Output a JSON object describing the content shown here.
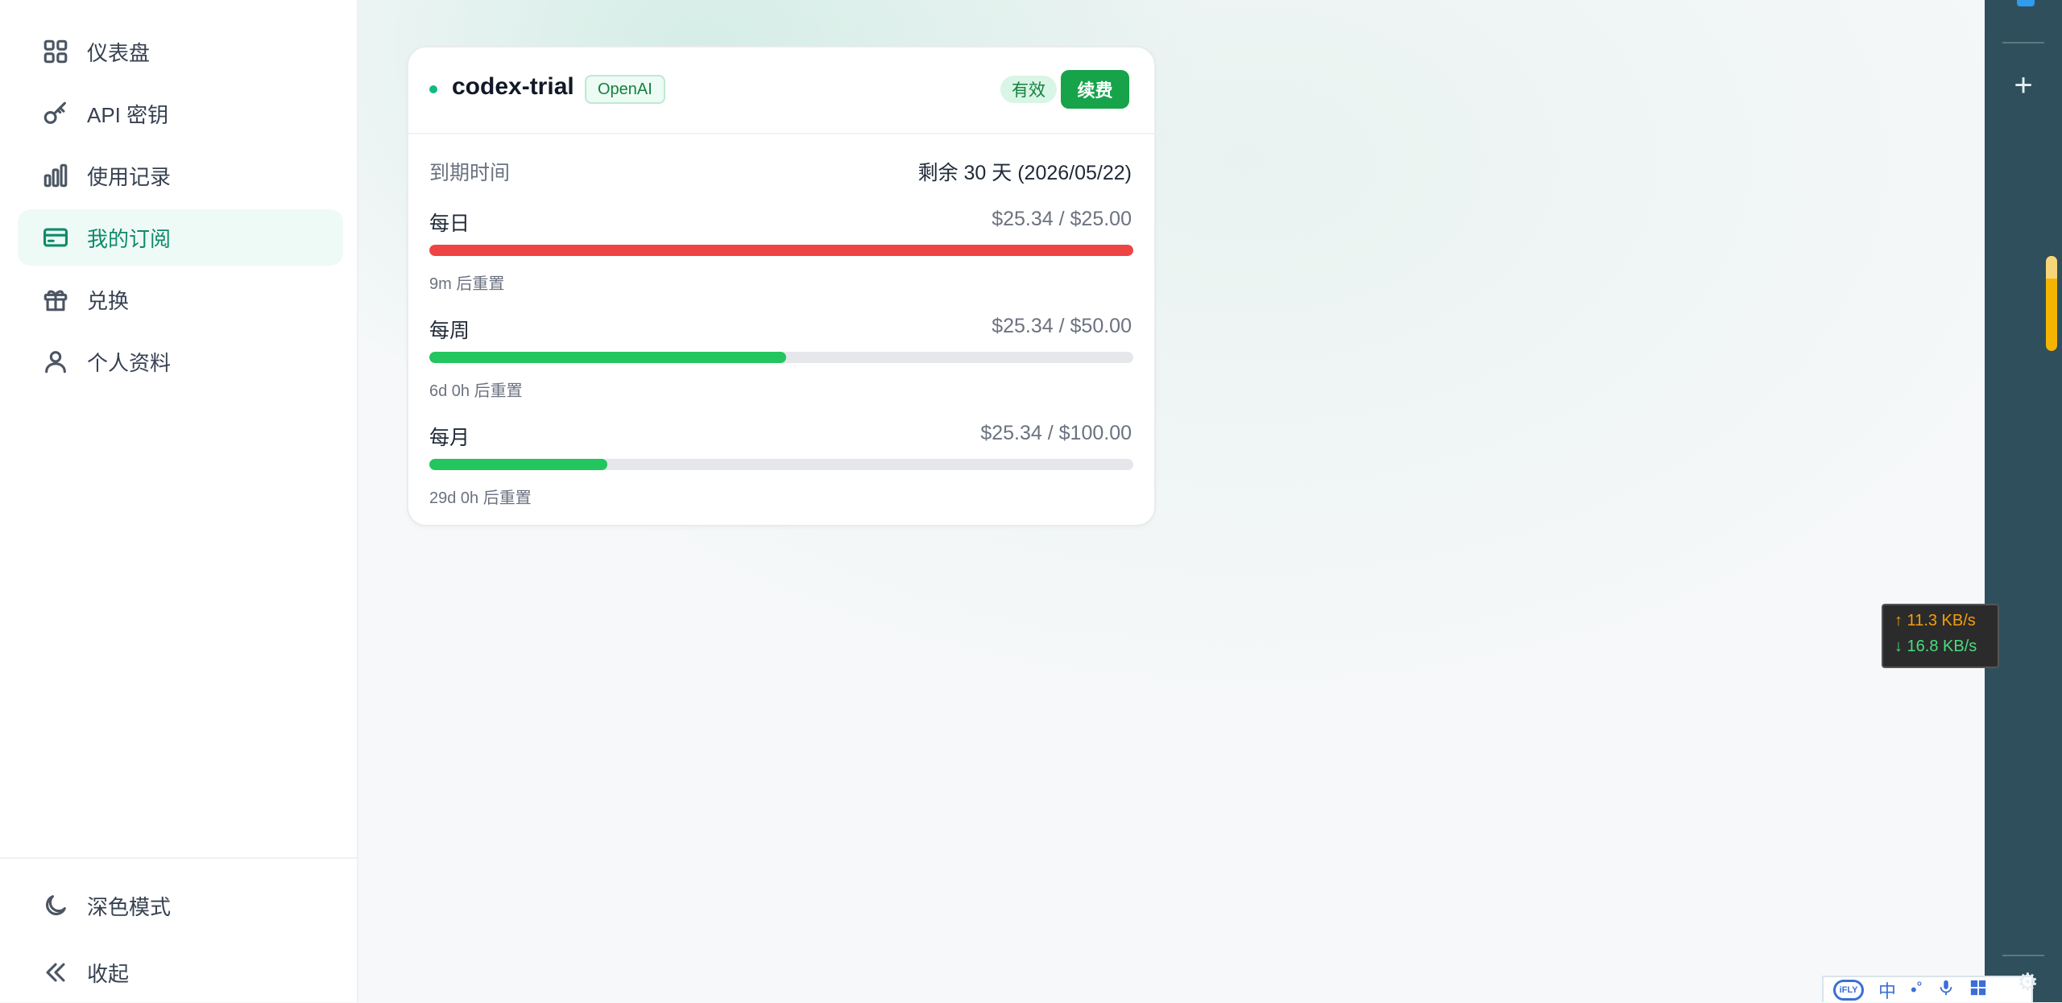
{
  "sidebar": {
    "items": [
      {
        "label": "仪表盘",
        "icon": "grid-icon",
        "active": false
      },
      {
        "label": "API 密钥",
        "icon": "key-icon",
        "active": false
      },
      {
        "label": "使用记录",
        "icon": "bar-chart-icon",
        "active": false
      },
      {
        "label": "我的订阅",
        "icon": "credit-card-icon",
        "active": true
      },
      {
        "label": "兑换",
        "icon": "gift-icon",
        "active": false
      },
      {
        "label": "个人资料",
        "icon": "user-icon",
        "active": false
      }
    ],
    "bottom": {
      "dark_mode_label": "深色模式",
      "collapse_label": "收起"
    }
  },
  "subscription": {
    "name": "codex-trial",
    "provider": "OpenAI",
    "status": "有效",
    "renew_label": "续费",
    "expiry_label": "到期时间",
    "expiry_value": "剩余 30 天 (2026/05/22)",
    "quotas": [
      {
        "label": "每日",
        "value": "$25.34 / $25.00",
        "progress": 1.0,
        "color": "#ef4444",
        "reset": "9m 后重置"
      },
      {
        "label": "每周",
        "value": "$25.34 / $50.00",
        "progress": 0.5068,
        "color": "#22c55e",
        "reset": "6d 0h 后重置"
      },
      {
        "label": "每月",
        "value": "$25.34 / $100.00",
        "progress": 0.2534,
        "color": "#22c55e",
        "reset": "29d 0h 后重置"
      }
    ]
  },
  "net_speed": {
    "up": "↑ 11.3 KB/s",
    "down": "↓ 16.8 KB/s"
  },
  "ime": {
    "logo": "iFLY",
    "mode": "中"
  },
  "colors": {
    "accent": "#0f8a6a",
    "renew": "#16a34a",
    "side_panel": "#2f4f5c"
  }
}
